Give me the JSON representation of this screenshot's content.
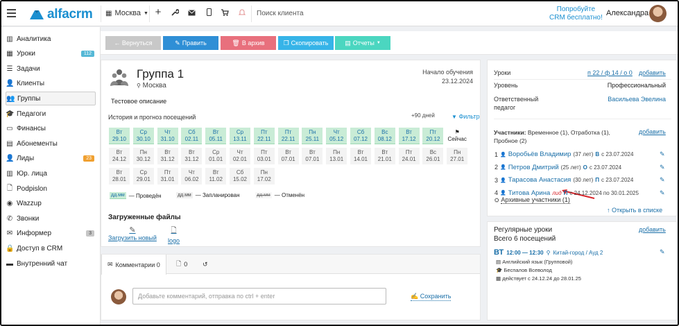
{
  "header": {
    "logo_text": "alfacrm",
    "city": "Москва",
    "search_placeholder": "Поиск клиента",
    "promo_line1": "Попробуйте",
    "promo_line2": "CRM бесплатно!",
    "user_name": "Александра"
  },
  "sidebar": {
    "items": [
      {
        "label": "Аналитика",
        "icon": "chart-icon"
      },
      {
        "label": "Уроки",
        "icon": "calendar-icon",
        "badge": "112"
      },
      {
        "label": "Задачи",
        "icon": "tasks-icon"
      },
      {
        "label": "Клиенты",
        "icon": "user-icon"
      },
      {
        "label": "Группы",
        "icon": "users-icon"
      },
      {
        "label": "Педагоги",
        "icon": "graduation-cap-icon"
      },
      {
        "label": "Финансы",
        "icon": "money-icon"
      },
      {
        "label": "Абонементы",
        "icon": "ticket-icon"
      },
      {
        "label": "Лиды",
        "icon": "user-plus-icon",
        "badge": "23"
      },
      {
        "label": "Юр. лица",
        "icon": "building-icon"
      },
      {
        "label": "Podpislon",
        "icon": "document-icon"
      },
      {
        "label": "Wazzup",
        "icon": "whatsapp-icon"
      },
      {
        "label": "Звонки",
        "icon": "phone-icon"
      },
      {
        "label": "Информер",
        "icon": "envelope-icon",
        "badge": "3"
      },
      {
        "label": "Доступ в CRM",
        "icon": "lock-icon"
      },
      {
        "label": "Внутренний чат",
        "icon": "chat-icon"
      }
    ]
  },
  "actions": {
    "back": "← Вернуться",
    "edit": "Править",
    "archive": "В архив",
    "copy": "Скопировать",
    "reports": "Отчеты"
  },
  "group": {
    "title": "Группа 1",
    "location": "Москва",
    "start_label": "Начало обучения",
    "start_date": "23.12.2024",
    "description": "Тестовое описание",
    "history_title": "История и прогноз посещений",
    "history_days": "+90 дней",
    "filter": "Фильтр",
    "now_label": "Сейчас",
    "cells": [
      {
        "d": "Вт",
        "dt": "29.10",
        "s": "done"
      },
      {
        "d": "Ср",
        "dt": "30.10",
        "s": "done"
      },
      {
        "d": "Чт",
        "dt": "31.10",
        "s": "done"
      },
      {
        "d": "Сб",
        "dt": "02.11",
        "s": "done"
      },
      {
        "d": "Вт",
        "dt": "05.11",
        "s": "done"
      },
      {
        "d": "Ср",
        "dt": "13.11",
        "s": "done"
      },
      {
        "d": "Пт",
        "dt": "22.11",
        "s": "done"
      },
      {
        "d": "Пт",
        "dt": "22.11",
        "s": "done"
      },
      {
        "d": "Пн",
        "dt": "25.11",
        "s": "done"
      },
      {
        "d": "Чт",
        "dt": "05.12",
        "s": "done"
      },
      {
        "d": "Сб",
        "dt": "07.12",
        "s": "done"
      },
      {
        "d": "Вс",
        "dt": "08.12",
        "s": "done"
      },
      {
        "d": "Вт",
        "dt": "17.12",
        "s": "done"
      },
      {
        "d": "Пт",
        "dt": "20.12",
        "s": "done"
      },
      {
        "d": "Вт",
        "dt": "24.12",
        "s": "plan"
      },
      {
        "d": "Пн",
        "dt": "30.12",
        "s": "plan"
      },
      {
        "d": "Вт",
        "dt": "31.12",
        "s": "plan"
      },
      {
        "d": "Вт",
        "dt": "31.12",
        "s": "plan"
      },
      {
        "d": "Ср",
        "dt": "01.01",
        "s": "plan"
      },
      {
        "d": "Чт",
        "dt": "02.01",
        "s": "plan"
      },
      {
        "d": "Пт",
        "dt": "03.01",
        "s": "plan"
      },
      {
        "d": "Вт",
        "dt": "07.01",
        "s": "plan"
      },
      {
        "d": "Вт",
        "dt": "07.01",
        "s": "plan"
      },
      {
        "d": "Пн",
        "dt": "13.01",
        "s": "plan"
      },
      {
        "d": "Вт",
        "dt": "14.01",
        "s": "plan"
      },
      {
        "d": "Вт",
        "dt": "21.01",
        "s": "plan"
      },
      {
        "d": "Пт",
        "dt": "24.01",
        "s": "plan"
      },
      {
        "d": "Вс",
        "dt": "26.01",
        "s": "plan"
      },
      {
        "d": "Пн",
        "dt": "27.01",
        "s": "plan"
      },
      {
        "d": "Вт",
        "dt": "28.01",
        "s": "plan"
      },
      {
        "d": "Ср",
        "dt": "29.01",
        "s": "plan"
      },
      {
        "d": "Пт",
        "dt": "31.01",
        "s": "plan"
      },
      {
        "d": "Чт",
        "dt": "06.02",
        "s": "plan"
      },
      {
        "d": "Вт",
        "dt": "11.02",
        "s": "plan"
      },
      {
        "d": "Сб",
        "dt": "15.02",
        "s": "plan"
      },
      {
        "d": "Пн",
        "dt": "17.02",
        "s": "plan"
      }
    ],
    "legend": [
      {
        "sw": "дд.мм",
        "label": "— Проведён",
        "s": "done"
      },
      {
        "sw": "дд.мм",
        "label": "— Запланирован",
        "s": "plan"
      },
      {
        "sw": "дд.мм",
        "label": "— Отменён",
        "s": "cancel"
      }
    ],
    "files_title": "Загруженные файлы",
    "upload_label": "Загрузить новый",
    "file_name": "logo"
  },
  "comments": {
    "tab_comments": "Комментарии 0",
    "tab_files": "0",
    "placeholder": "Добавьте комментарий, отправка по ctrl + enter",
    "save": "Сохранить"
  },
  "right": {
    "lessons_label": "Уроки",
    "lessons_val": "п 22 / ф 14 / о 0",
    "add": "добавить",
    "level_label": "Уровень",
    "level_val": "Профессиональный",
    "resp_label1": "Ответственный",
    "resp_label2": "педагог",
    "resp_val": "Васильева Эвелина",
    "members_label": "Участники:",
    "members_note1": "Временное (1), Отработка (1),",
    "members_note2": "Пробное (2)",
    "members": [
      {
        "n": "1",
        "name": "Воробьёв Владимир",
        "age": "(37 лет)",
        "badge": "В",
        "since": "с 23.07.2024"
      },
      {
        "n": "2",
        "name": "Петров Дмитрий",
        "age": "(25 лет)",
        "badge": "О",
        "since": "с 23.07.2024"
      },
      {
        "n": "3",
        "name": "Тарасова Анастасия",
        "age": "(30 лет)",
        "badge": "П",
        "since": "с 23.07.2024"
      },
      {
        "n": "4",
        "name": "Титова Арина",
        "age": "лид",
        "badge": "П",
        "since": "с 24.12.2024 по 30.01.2025"
      }
    ],
    "archive_members": "Архивные участники (1)",
    "open_list": "Открыть в списке",
    "regular_title": "Регулярные уроки",
    "regular_total": "Всего 6 посещений",
    "reg_day": "ВТ",
    "reg_time": "12:00 — 12:30",
    "reg_place": "Китай-город / Ауд 2",
    "reg_subject": "Английский язык (Групповой)",
    "reg_teacher": "Беспалов Всеволод",
    "reg_period": "действует с 24.12.24 до 28.01.25"
  }
}
